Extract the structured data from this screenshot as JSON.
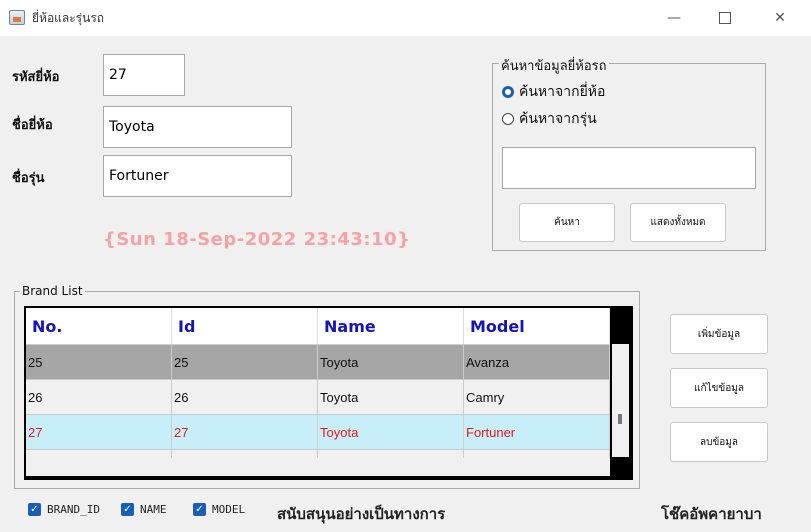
{
  "window": {
    "title": "ยี่ห้อและรุ่นรถ",
    "minimize": "—",
    "close": "✕"
  },
  "form": {
    "brand_code_label": "รหัสยี่ห้อ",
    "brand_code_value": "27",
    "brand_name_label": "ชื่อยี่ห้อ",
    "brand_name_value": "Toyota",
    "model_label": "ชื่อรุ่น",
    "model_value": "Fortuner",
    "clock": "{Sun 18-Sep-2022   23:43:10}"
  },
  "search": {
    "group_title": "ค้นหาข้อมูลยี่ห้อรถ",
    "options": [
      "ค้นหาจากยี่ห้อ",
      "ค้นหาจากรุ่น"
    ],
    "selected_index": 0,
    "query": "",
    "search_button": "ค้นหา",
    "show_all_button": "แสดงทั้งหมด"
  },
  "brand_list": {
    "group_title": "Brand List",
    "columns": [
      "No.",
      "Id",
      "Name",
      "Model"
    ],
    "rows": [
      [
        "25",
        "25",
        "Toyota",
        "Avanza"
      ],
      [
        "26",
        "26",
        "Toyota",
        "Camry"
      ],
      [
        "27",
        "27",
        "Toyota",
        "Fortuner"
      ]
    ]
  },
  "actions": {
    "add": "เพิ่มข้อมูล",
    "edit": "แก้ไขข้อมูล",
    "delete": "ลบข้อมูล"
  },
  "checkboxes": [
    "BRAND_ID",
    "NAME",
    "MODEL"
  ],
  "footer": {
    "left": "สนับสนุนอย่างเป็นทางการ",
    "right": "โช๊คอัพคายาบา"
  },
  "colors": {
    "accent": "#1a5fb4",
    "header_text": "#1515b5",
    "selected_row": "#c8eef9",
    "selected_text": "#e01a1a",
    "clock": "#f4a3a3"
  }
}
